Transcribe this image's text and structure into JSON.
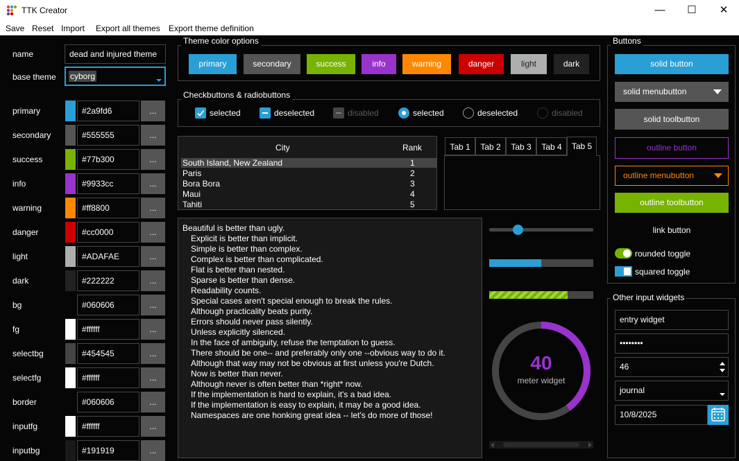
{
  "window": {
    "title": "TTK Creator",
    "controls": {
      "minimize": "—",
      "maximize": "☐",
      "close": "✕"
    }
  },
  "menu": [
    "Save",
    "Reset",
    "Import",
    "Export all themes",
    "Export theme definition"
  ],
  "left": {
    "name_label": "name",
    "name_value": "dead and injured theme",
    "base_label": "base theme",
    "base_value": "cyborg",
    "colors": [
      {
        "label": "primary",
        "value": "#2a9fd6",
        "swatch": "#2a9fd6"
      },
      {
        "label": "secondary",
        "value": "#555555",
        "swatch": "#555555"
      },
      {
        "label": "success",
        "value": "#77b300",
        "swatch": "#77b300"
      },
      {
        "label": "info",
        "value": "#9933cc",
        "swatch": "#9933cc"
      },
      {
        "label": "warning",
        "value": "#ff8800",
        "swatch": "#ff8800"
      },
      {
        "label": "danger",
        "value": "#cc0000",
        "swatch": "#cc0000"
      },
      {
        "label": "light",
        "value": "#ADAFAE",
        "swatch": "#ADAFAE"
      },
      {
        "label": "dark",
        "value": "#222222",
        "swatch": "#222222"
      },
      {
        "label": "bg",
        "value": "#060606",
        "swatch": "#060606"
      },
      {
        "label": "fg",
        "value": "#ffffff",
        "swatch": "#ffffff"
      },
      {
        "label": "selectbg",
        "value": "#454545",
        "swatch": "#454545"
      },
      {
        "label": "selectfg",
        "value": "#ffffff",
        "swatch": "#ffffff"
      },
      {
        "label": "border",
        "value": "#060606",
        "swatch": "#060606"
      },
      {
        "label": "inputfg",
        "value": "#ffffff",
        "swatch": "#ffffff"
      },
      {
        "label": "inputbg",
        "value": "#191919",
        "swatch": "#191919"
      }
    ],
    "dots": "..."
  },
  "theme_colors": {
    "title": "Theme color options",
    "buttons": [
      {
        "label": "primary",
        "bg": "#2a9fd6",
        "fg": "#ffffff"
      },
      {
        "label": "secondary",
        "bg": "#555555",
        "fg": "#ffffff"
      },
      {
        "label": "success",
        "bg": "#77b300",
        "fg": "#ffffff"
      },
      {
        "label": "info",
        "bg": "#9933cc",
        "fg": "#ffffff"
      },
      {
        "label": "warning",
        "bg": "#ff8800",
        "fg": "#ffffff"
      },
      {
        "label": "danger",
        "bg": "#cc0000",
        "fg": "#ffffff"
      },
      {
        "label": "light",
        "bg": "#ADAFAE",
        "fg": "#222222"
      },
      {
        "label": "dark",
        "bg": "#222222",
        "fg": "#ffffff"
      }
    ]
  },
  "checks": {
    "title": "Checkbuttons & radiobuttons",
    "checked": "selected",
    "deselected": "deselected",
    "disabled": "disabled",
    "radio_selected": "selected",
    "radio_deselected": "deselected",
    "radio_disabled": "disabled"
  },
  "table": {
    "headers": [
      "City",
      "Rank"
    ],
    "rows": [
      [
        "South Island, New Zealand",
        "1"
      ],
      [
        "Paris",
        "2"
      ],
      [
        "Bora Bora",
        "3"
      ],
      [
        "Maui",
        "4"
      ],
      [
        "Tahiti",
        "5"
      ]
    ]
  },
  "tabs": [
    "Tab 1",
    "Tab 2",
    "Tab 3",
    "Tab 4",
    "Tab 5"
  ],
  "zen": [
    "Beautiful is better than ugly.",
    "Explicit is better than implicit.",
    "Simple is better than complex.",
    "Complex is better than complicated.",
    "Flat is better than nested.",
    "Sparse is better than dense.",
    "Readability counts.",
    "Special cases aren't special enough to break the rules.",
    "Although practicality beats purity.",
    "Errors should never pass silently.",
    "Unless explicitly silenced.",
    "In the face of ambiguity, refuse the temptation to guess.",
    "There should be one-- and preferably only one --obvious way to do it.",
    "Although that way may not be obvious at first unless you're Dutch.",
    "Now is better than never.",
    "Although never is often better than *right* now.",
    "If the implementation is hard to explain, it's a bad idea.",
    "If the implementation is easy to explain, it may be a good idea.",
    "Namespaces are one honking great idea -- let's do more of those!"
  ],
  "widgets": {
    "scale_value": 0.27,
    "progress_value": 0.5,
    "striped_value": 0.75,
    "meter_value": "40",
    "meter_label": "meter widget",
    "meter_fraction": 0.4
  },
  "buttons_frame": {
    "title": "Buttons",
    "solid_button": "solid button",
    "solid_menubutton": "solid menubutton",
    "solid_toolbutton": "solid toolbutton",
    "outline_button": "outline button",
    "outline_menubutton": "outline menubutton",
    "outline_toolbutton": "outline toolbutton",
    "link_button": "link button",
    "rounded_toggle": "rounded toggle",
    "squared_toggle": "squared toggle"
  },
  "inputs": {
    "title": "Other input widgets",
    "entry": "entry widget",
    "password": "••••••••",
    "spinbox": "46",
    "combobox": "journal",
    "date": "10/8/2025"
  }
}
